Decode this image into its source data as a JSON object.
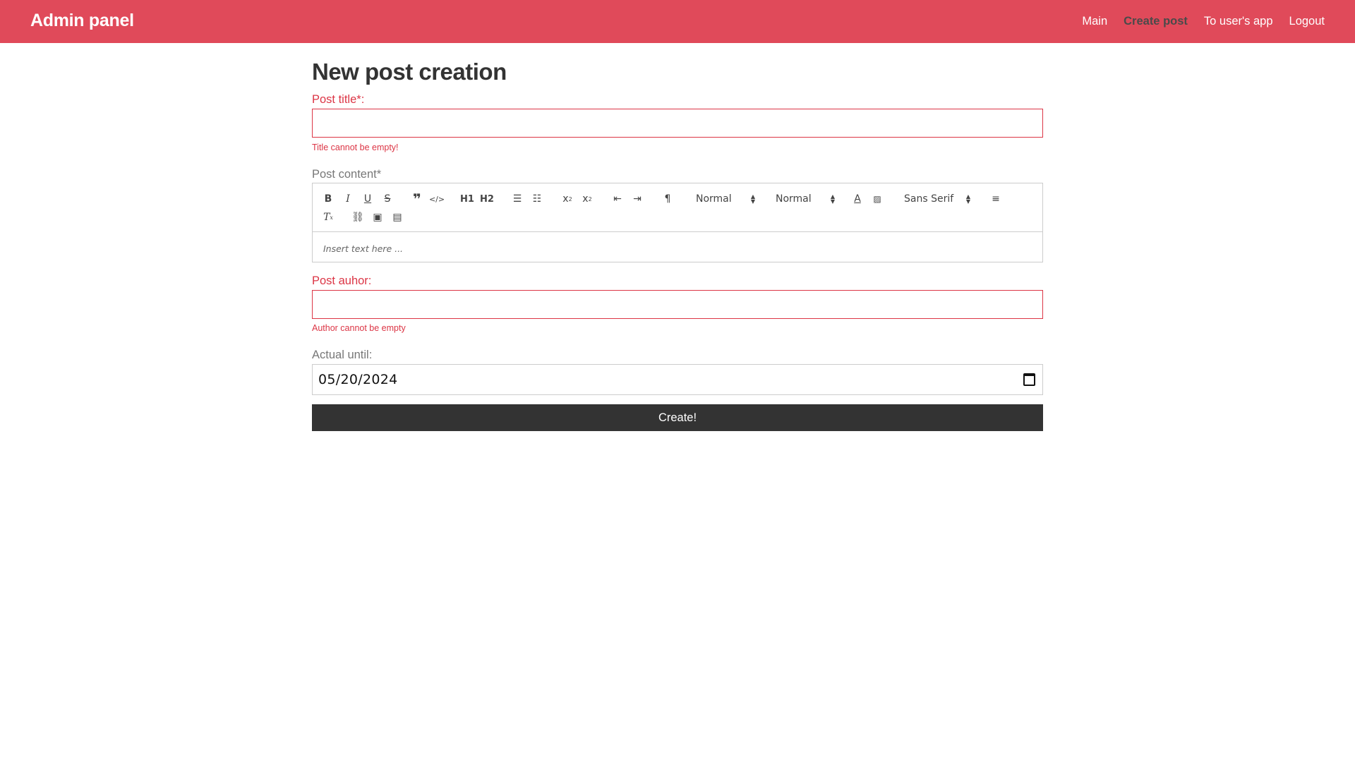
{
  "navbar": {
    "brand": "Admin panel",
    "links": [
      {
        "label": "Main"
      },
      {
        "label": "Create post"
      },
      {
        "label": "To user's app"
      },
      {
        "label": "Logout"
      }
    ]
  },
  "page": {
    "title": "New post creation"
  },
  "form": {
    "title_label": "Post title*:",
    "title_value": "",
    "title_error": "Title cannot be empty!",
    "content_label": "Post content*",
    "content_placeholder": "Insert text here ...",
    "author_label": "Post auhor:",
    "author_value": "",
    "author_error": "Author cannot be empty",
    "actual_until_label": "Actual until:",
    "actual_until_value": "05/20/2024",
    "submit_label": "Create!"
  },
  "toolbar": {
    "header_picker": "Normal",
    "size_picker": "Normal",
    "font_picker": "Sans Serif",
    "h1_label": "H1",
    "h2_label": "H2"
  },
  "colors": {
    "navbar": "#e04a5a",
    "error": "#dc3545",
    "button": "#333333"
  }
}
